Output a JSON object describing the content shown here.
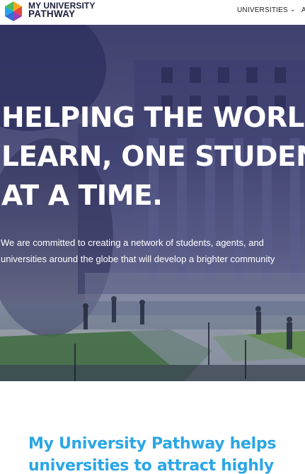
{
  "brand": {
    "line1": "MY UNIVERSITY",
    "line2": "PATHWAY"
  },
  "nav": {
    "universities_label": "UNIVERSITIES",
    "clipped_label": "A"
  },
  "hero": {
    "headline_lines": [
      "HELPING THE WORLD",
      "LEARN, ONE STUDENT",
      "AT A TIME."
    ],
    "body_lines": [
      "We are committed to creating a network of students, agents, and",
      "universities around the globe that will develop a brighter community"
    ]
  },
  "intro": {
    "heading_lines": [
      "My University Pathway helps",
      "universities to attract highly"
    ]
  },
  "colors": {
    "brand_blue": "#2aa6e6",
    "hero_overlay": "#26265a",
    "nav_text": "#222222"
  }
}
